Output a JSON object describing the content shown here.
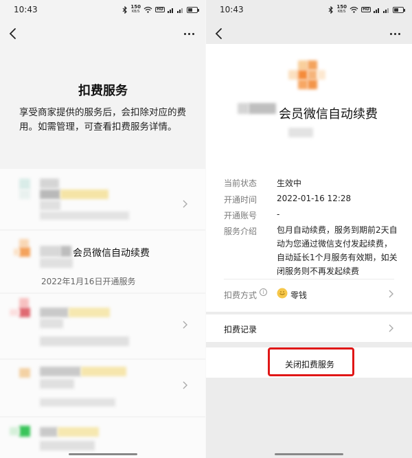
{
  "status_bar": {
    "left": {
      "time": "10:43",
      "speed": "150",
      "speed_unit": "KB/S"
    },
    "right": {
      "time": "10:43",
      "speed": "150",
      "speed_unit": "KB/S"
    },
    "icons": [
      "bluetooth-icon",
      "wifi-icon",
      "hd-icon",
      "signal-icon",
      "signal-icon",
      "battery-icon"
    ]
  },
  "left_screen": {
    "title": "扣费服务",
    "description": "享受商家提供的服务后，会扣除对应的费用。如需管理，可查看扣费服务详情。",
    "services": [
      {
        "name": "",
        "date": ""
      },
      {
        "name": "会员微信自动续费",
        "date": "2022年1月16日开通服务"
      },
      {
        "name": "",
        "date": ""
      },
      {
        "name": "",
        "date": ""
      },
      {
        "name": "",
        "date": ""
      }
    ]
  },
  "right_screen": {
    "service_name": "会员微信自动续费",
    "rows": [
      {
        "label": "当前状态",
        "value": "生效中"
      },
      {
        "label": "开通时间",
        "value": "2022-01-16 12:28"
      },
      {
        "label": "开通账号",
        "value": "-"
      },
      {
        "label": "服务介绍",
        "value": "包月自动续费，服务到期前2天自动为您通过微信支付发起续费，自动延长1个月服务有效期，如关闭服务则不再发起续费"
      }
    ],
    "payment_method": {
      "label": "扣费方式",
      "value": "零钱"
    },
    "record_label": "扣费记录",
    "close_label": "关闭扣费服务"
  },
  "colors": {
    "highlight_border": "#e01616",
    "wallet_icon": "#f6c74a"
  }
}
